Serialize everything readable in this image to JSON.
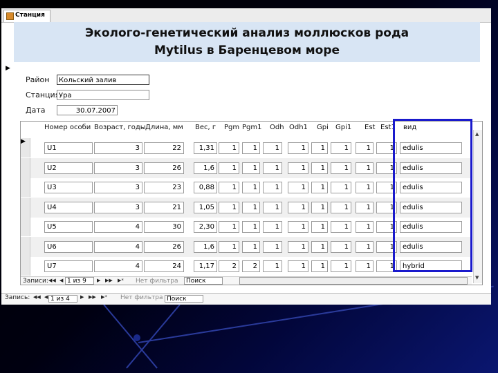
{
  "tab": {
    "label": "Станция"
  },
  "header": {
    "line1": "Эколого-генетический анализ моллюсков рода",
    "line2": "Mytilus в Баренцевом море"
  },
  "fields": {
    "district": {
      "label": "Район",
      "value": "Кольский залив"
    },
    "station": {
      "label": "Станция",
      "value": "Ура"
    },
    "date": {
      "label": "Дата",
      "value": "30.07.2007"
    }
  },
  "table": {
    "columns": [
      "Номер особи",
      "Возраст, годы",
      "Длина, мм",
      "Вес, г",
      "Pgm",
      "Pgm1",
      "Odh",
      "Odh1",
      "Gpi",
      "Gpi1",
      "Est",
      "Est1",
      "вид"
    ],
    "rows": [
      [
        "U1",
        "3",
        "22",
        "1,31",
        "1",
        "1",
        "1",
        "1",
        "1",
        "1",
        "1",
        "1",
        "edulis"
      ],
      [
        "U2",
        "3",
        "26",
        "1,6",
        "1",
        "1",
        "1",
        "1",
        "1",
        "1",
        "1",
        "1",
        "edulis"
      ],
      [
        "U3",
        "3",
        "23",
        "0,88",
        "1",
        "1",
        "1",
        "1",
        "1",
        "1",
        "1",
        "1",
        "edulis"
      ],
      [
        "U4",
        "3",
        "21",
        "1,05",
        "1",
        "1",
        "1",
        "1",
        "1",
        "1",
        "1",
        "1",
        "edulis"
      ],
      [
        "U5",
        "4",
        "30",
        "2,30",
        "1",
        "1",
        "1",
        "1",
        "1",
        "1",
        "1",
        "1",
        "edulis"
      ],
      [
        "U6",
        "4",
        "26",
        "1,6",
        "1",
        "1",
        "1",
        "1",
        "1",
        "1",
        "1",
        "1",
        "edulis"
      ],
      [
        "U7",
        "4",
        "24",
        "1,17",
        "2",
        "2",
        "1",
        "1",
        "1",
        "1",
        "1",
        "1",
        "hybrid"
      ]
    ]
  },
  "subform_nav": {
    "label": "Записи:",
    "position": "1 из 9",
    "filter": "Нет фильтра",
    "search": "Поиск"
  },
  "main_nav": {
    "label": "Запись:",
    "position": "1 из 4",
    "filter": "Нет фильтра",
    "search": "Поиск"
  },
  "icons": {
    "first": "◀◀",
    "prev": "◀",
    "next": "▶",
    "last": "▶▶",
    "new": "▶*"
  },
  "colors": {
    "highlight": "#1a1acc",
    "header_bg": "#d8e5f4"
  }
}
